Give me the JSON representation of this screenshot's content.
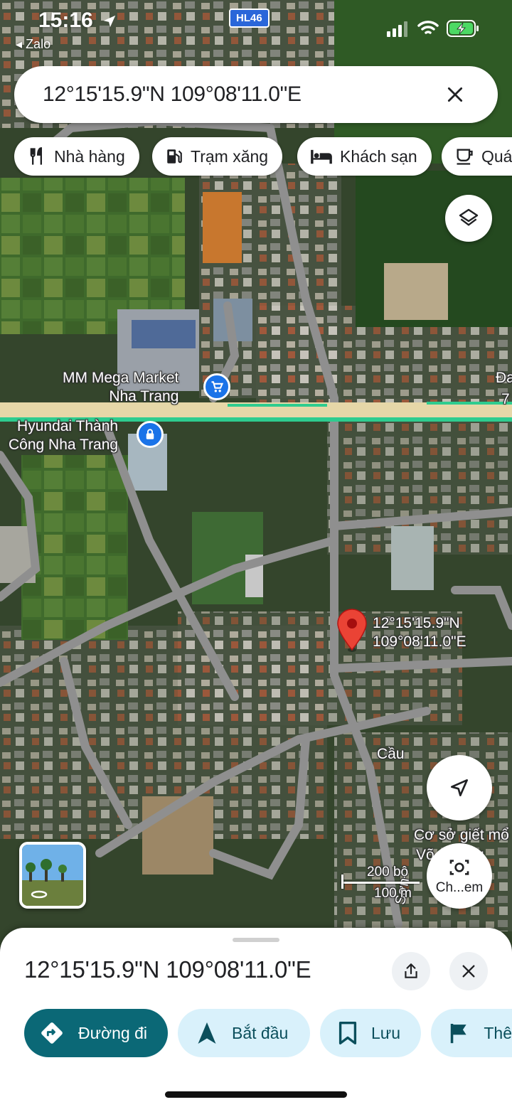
{
  "status_bar": {
    "time": "15:16",
    "back_app": "Zalo",
    "route_shield": "HL46"
  },
  "search": {
    "query": "12°15'15.9\"N 109°08'11.0\"E"
  },
  "chips": [
    {
      "label": "Nhà hàng",
      "icon": "restaurant-icon"
    },
    {
      "label": "Trạm xăng",
      "icon": "gas-station-icon"
    },
    {
      "label": "Khách sạn",
      "icon": "hotel-icon"
    },
    {
      "label": "Quá",
      "icon": "coffee-icon"
    }
  ],
  "map": {
    "places": {
      "mega_market": "MM Mega Market Nha Trang",
      "mega_market_line1": "MM Mega Market",
      "mega_market_line2": "Nha Trang",
      "hyundai_line1": "Hyundai Thành",
      "hyundai_line2": "Công Nha Trang",
      "bridge": "Cầu",
      "slaughter_line1": "Cơ sở giết mổ",
      "slaughter_line2": "Võ... hàng",
      "edge_a": "Đa",
      "edge_b": "7",
      "street_vertical": "Sơn"
    },
    "pin_label_line1": "12°15'15.9\"N",
    "pin_label_line2": "109°08'11.0\"E",
    "scale": {
      "imperial": "200 bộ",
      "metric": "100 m"
    },
    "camera_label": "Ch...em"
  },
  "sheet": {
    "title": "12°15'15.9\"N 109°08'11.0\"E",
    "actions": [
      {
        "label": "Đường đi",
        "primary": true
      },
      {
        "label": "Bắt đầu"
      },
      {
        "label": "Lưu"
      },
      {
        "label": "Thê"
      }
    ]
  },
  "colors": {
    "primary_teal": "#0b6876",
    "light_action_bg": "#d9f1fb",
    "pin_red": "#ea4335",
    "road_green": "#2ecc8f"
  }
}
